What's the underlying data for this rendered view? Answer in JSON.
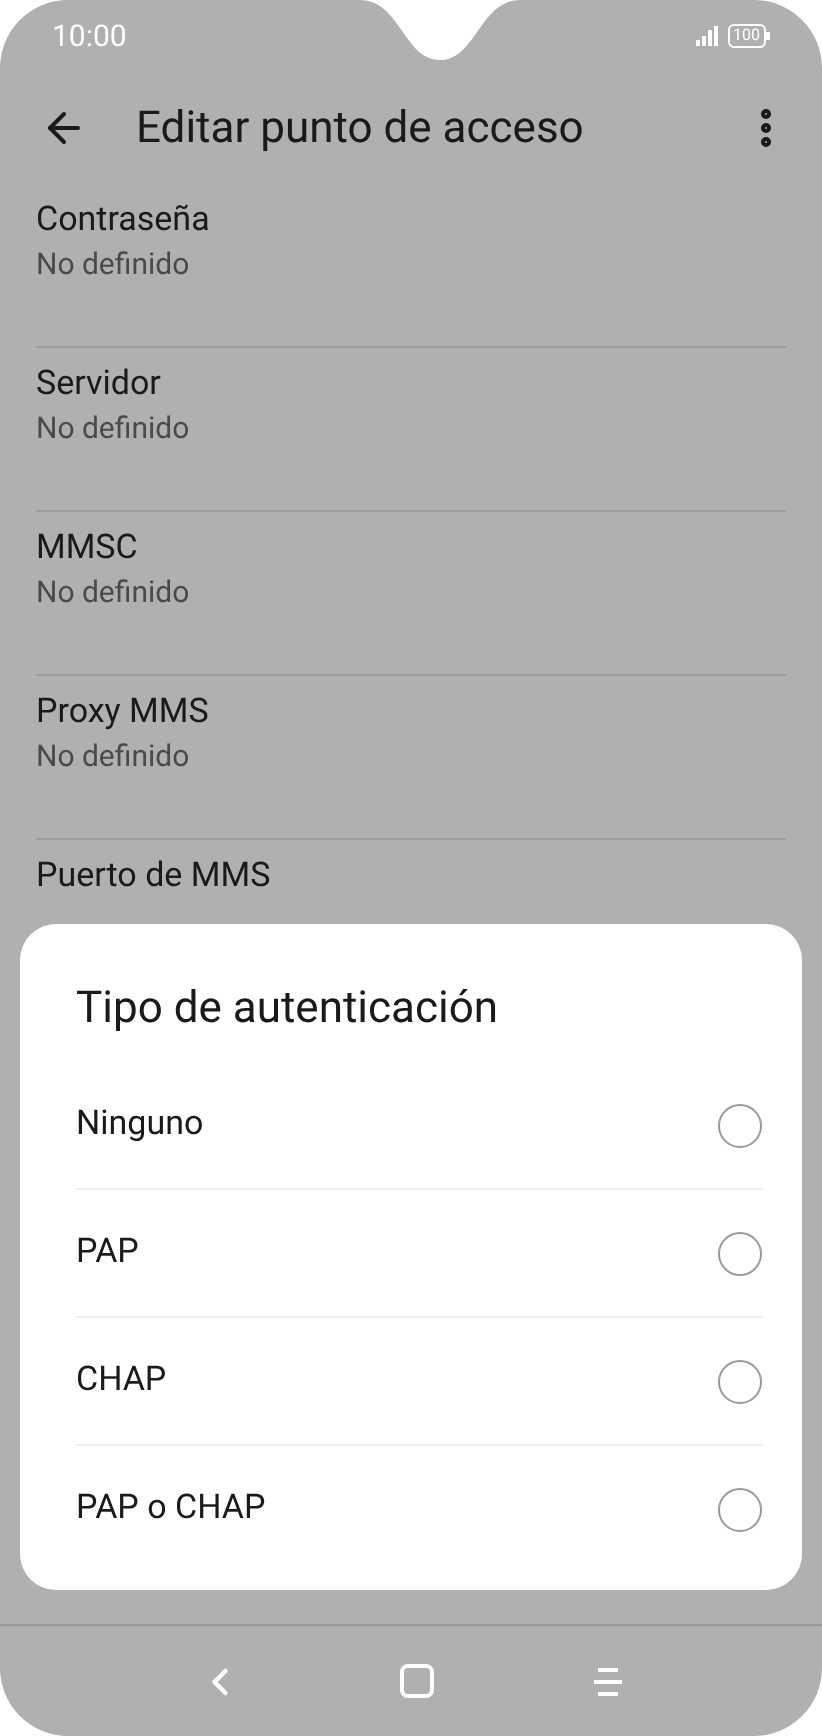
{
  "status_bar": {
    "time": "10:00",
    "battery": "100"
  },
  "header": {
    "title": "Editar punto de acceso"
  },
  "settings": [
    {
      "title": "Contraseña",
      "value": "No definido"
    },
    {
      "title": "Servidor",
      "value": "No definido"
    },
    {
      "title": "MMSC",
      "value": "No definido"
    },
    {
      "title": "Proxy MMS",
      "value": "No definido"
    },
    {
      "title": "Puerto de MMS"
    }
  ],
  "dialog": {
    "title": "Tipo de autenticación",
    "options": [
      {
        "label": "Ninguno",
        "selected": false
      },
      {
        "label": "PAP",
        "selected": false
      },
      {
        "label": "CHAP",
        "selected": false
      },
      {
        "label": "PAP o CHAP",
        "selected": false
      }
    ]
  }
}
